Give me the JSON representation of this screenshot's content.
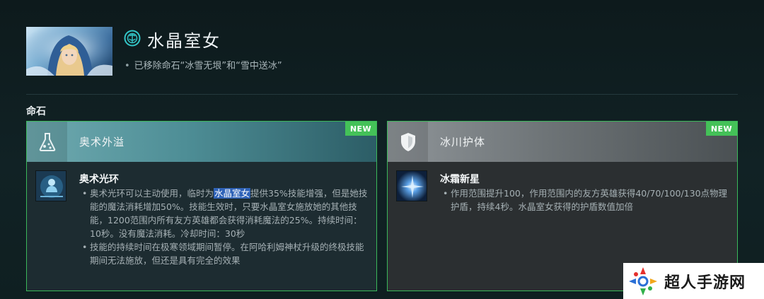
{
  "hero": {
    "name": "水晶室女",
    "note": "已移除命石“冰雪无垠”和“雪中送冰”",
    "portrait_icon": "crystal-maiden-portrait",
    "attribute_icon": "intelligence-icon"
  },
  "section": {
    "title": "命石"
  },
  "cards": [
    {
      "header_title": "奥术外溢",
      "header_icon": "flask-icon",
      "badge": "NEW",
      "ability_name": "奥术光环",
      "ability_icon": "arcane-aura-icon",
      "bullet1_pre": "奥术光环可以主动使用，临时为",
      "bullet1_highlight": "水晶室女",
      "bullet1_post": "提供35%技能增强，但是她技能的魔法消耗增加50%。技能生效时，只要水晶室女施放她的其他技能，1200范围内所有友方英雄都会获得消耗魔法的25%。持续时间：10秒。没有魔法消耗。冷却时间：30秒",
      "bullet2": "技能的持续时间在极寒领域期间暂停。在阿哈利姆神杖升级的终极技能期间无法施放，但还是具有完全的效果"
    },
    {
      "header_title": "冰川护体",
      "header_icon": "shield-icon",
      "badge": "NEW",
      "ability_name": "冰霜新星",
      "ability_icon": "crystal-nova-icon",
      "bullet1": "作用范围提升100，作用范围内的友方英雄获得40/70/100/130点物理护盾，持续4秒。水晶室女获得的护盾数值加倍"
    }
  ],
  "watermark": {
    "text": "超人手游网",
    "logo_icon": "site-logo-icon"
  },
  "colors": {
    "card_border": "#3bb85a",
    "badge": "#44c158",
    "highlight": "#2f63b8"
  }
}
